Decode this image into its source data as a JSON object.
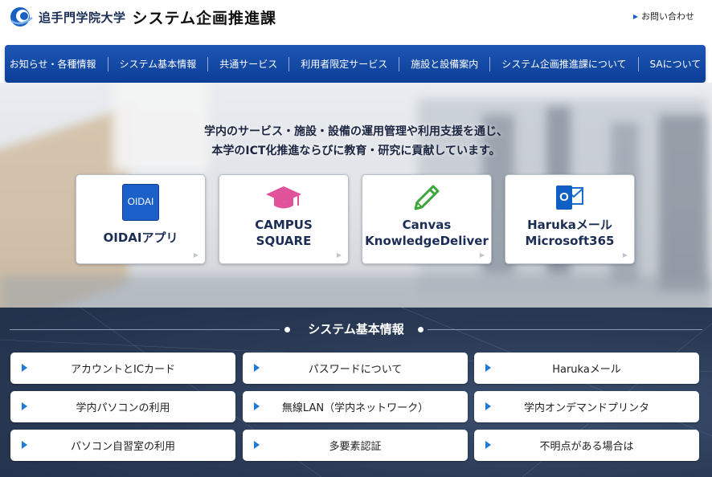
{
  "header": {
    "university": "追手門学院大学",
    "department": "システム企画推進課",
    "contact": "お問い合わせ"
  },
  "nav": [
    "お知らせ・各種情報",
    "システム基本情報",
    "共通サービス",
    "利用者限定サービス",
    "施設と設備案内",
    "システム企画推進課について",
    "SAについて"
  ],
  "hero": {
    "line1": "学内のサービス・施設・設備の運用管理や利用支援を通じ、",
    "line2": "本学のICT化推進ならびに教育・研究に貢献しています。",
    "cards": [
      {
        "icon": "oidai-app-icon",
        "icon_text": "OIDAI",
        "line1": "OIDAIアプリ",
        "line2": ""
      },
      {
        "icon": "graduation-cap-icon",
        "line1": "CAMPUS",
        "line2": "SQUARE"
      },
      {
        "icon": "pencil-icon",
        "line1": "Canvas",
        "line2": "KnowledgeDeliver"
      },
      {
        "icon": "outlook-icon",
        "icon_text": "O",
        "line1": "Harukaメール",
        "line2": "Microsoft365"
      }
    ]
  },
  "section": {
    "title": "システム基本情報",
    "links": [
      "アカウントとICカード",
      "パスワードについて",
      "Harukaメール",
      "学内パソコンの利用",
      "無線LAN（学内ネットワーク）",
      "学内オンデマンドプリンタ",
      "パソコン自習室の利用",
      "多要素認証",
      "不明点がある場合は"
    ]
  },
  "colors": {
    "nav": "#0b3e97",
    "accent": "#1f7bd6",
    "section_bg": "#2a3a55",
    "campus_pink": "#e0529a",
    "canvas_green": "#3da63a"
  }
}
